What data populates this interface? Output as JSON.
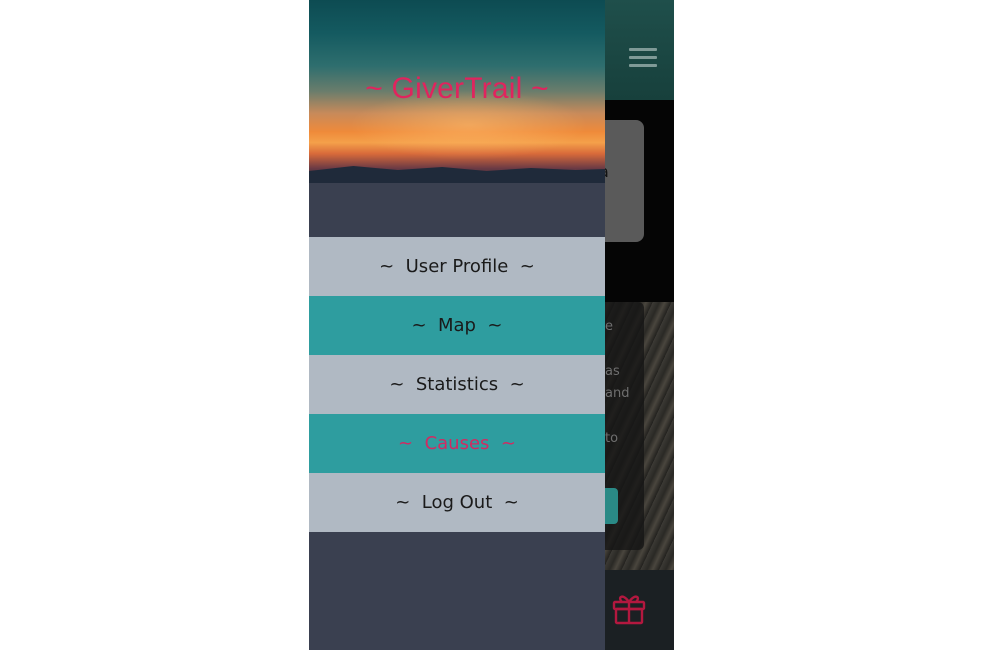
{
  "app": {
    "title": "~ GiverTrail ~",
    "accent_color": "#e0245e",
    "drawer_color": "#3a4050",
    "teal_color": "#2e9d9f",
    "light_item_color": "#b0b9c3"
  },
  "header": {
    "menu_icon": "hamburger-icon"
  },
  "menu": {
    "items": [
      {
        "label": "~  User Profile  ~",
        "style": "light",
        "active": false
      },
      {
        "label": "~  Map  ~",
        "style": "teal",
        "active": false
      },
      {
        "label": "~  Statistics  ~",
        "style": "light",
        "active": false
      },
      {
        "label": "~  Causes  ~",
        "style": "teal",
        "active": true
      },
      {
        "label": "~  Log Out  ~",
        "style": "light",
        "active": false
      }
    ]
  },
  "background": {
    "card_text": "a",
    "snippets": [
      "e",
      "as",
      "and",
      "to"
    ]
  },
  "bottom_bar": {
    "icon": "gift-icon"
  }
}
